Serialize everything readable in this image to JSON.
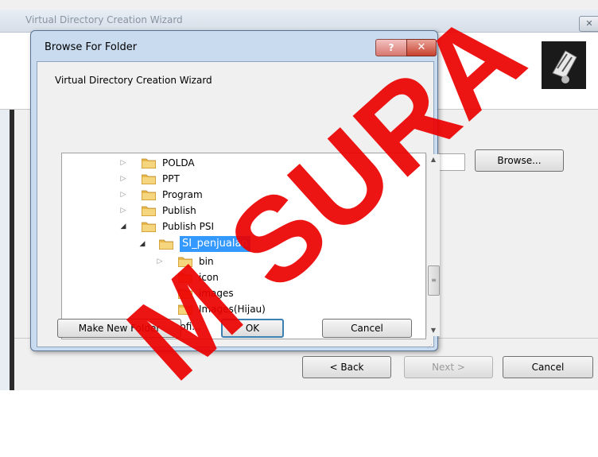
{
  "wizard": {
    "title": "Virtual Directory Creation Wizard",
    "close_glyph": "✕",
    "browse_label": "Browse...",
    "back_label": "< Back",
    "next_label": "Next >",
    "cancel_label": "Cancel"
  },
  "dialog": {
    "title": "Browse For Folder",
    "help_glyph": "?",
    "close_glyph": "✕",
    "description": "Virtual Directory Creation Wizard",
    "tree": [
      {
        "label": "POLDA",
        "expanded": false
      },
      {
        "label": "PPT",
        "expanded": false
      },
      {
        "label": "Program",
        "expanded": false
      },
      {
        "label": "Publish",
        "expanded": false
      },
      {
        "label": "Publish PSI",
        "expanded": true
      },
      {
        "label": "SI_penjualan",
        "expanded": true,
        "selected": true
      },
      {
        "label": "bin",
        "expanded": false
      },
      {
        "label": "icon"
      },
      {
        "label": "images"
      },
      {
        "label": "Images(Hijau)"
      },
      {
        "label": "Si...ofi..."
      }
    ],
    "make_new_folder_label": "Make New Folder",
    "ok_label": "OK",
    "cancel_label": "Cancel"
  },
  "watermark": "M SURA",
  "colors": {
    "selection": "#3399ff",
    "watermark": "#ec0000",
    "folder": "#e8b84a"
  }
}
